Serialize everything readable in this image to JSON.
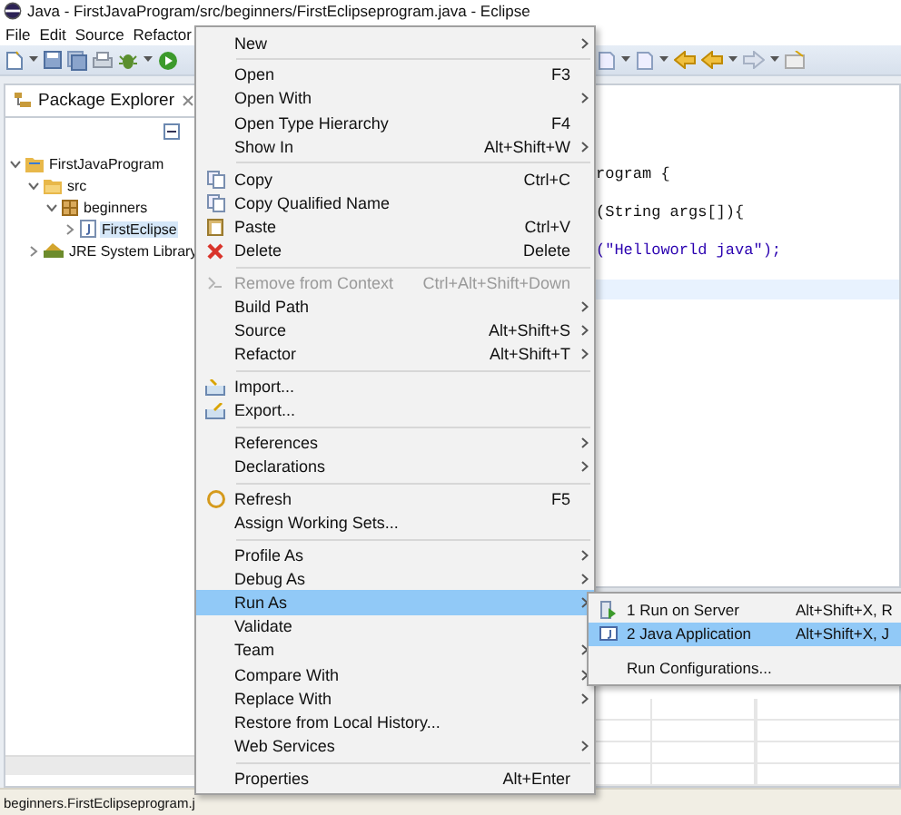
{
  "window": {
    "title": "Java - FirstJavaProgram/src/beginners/FirstEclipseprogram.java - Eclipse"
  },
  "menubar": [
    "File",
    "Edit",
    "Source",
    "Refactor"
  ],
  "package_explorer": {
    "title": "Package Explorer",
    "tree": [
      {
        "label": "FirstJavaProgram",
        "expanded": true,
        "children": [
          {
            "label": "src",
            "expanded": true,
            "children": [
              {
                "label": "beginners",
                "expanded": true,
                "children": [
                  {
                    "label": "FirstEclipse",
                    "expanded": false,
                    "selected": true
                  }
                ]
              }
            ]
          },
          {
            "label": "JRE System Library",
            "expanded": false,
            "selected": false
          }
        ]
      }
    ]
  },
  "editor": {
    "lines": [
      "rogram {",
      "(String args[]){",
      "(\"Helloworld java\");"
    ]
  },
  "context_menu": {
    "items": [
      {
        "kind": "command",
        "label": "New",
        "submenu": true,
        "disabled": false,
        "selected": false
      },
      {
        "kind": "separator"
      },
      {
        "kind": "command",
        "label": "Open",
        "shortcut": "F3",
        "submenu": false,
        "disabled": false,
        "selected": false
      },
      {
        "kind": "command",
        "label": "Open With",
        "submenu": true,
        "disabled": false,
        "selected": false
      },
      {
        "kind": "command",
        "label": "Open Type Hierarchy",
        "shortcut": "F4",
        "submenu": false,
        "disabled": false,
        "selected": false
      },
      {
        "kind": "command",
        "label": "Show In",
        "shortcut": "Alt+Shift+W",
        "submenu": true,
        "disabled": false,
        "selected": false
      },
      {
        "kind": "separator"
      },
      {
        "kind": "command",
        "label": "Copy",
        "shortcut": "Ctrl+C",
        "submenu": false,
        "disabled": false,
        "selected": false
      },
      {
        "kind": "command",
        "label": "Copy Qualified Name",
        "submenu": false,
        "disabled": false,
        "selected": false
      },
      {
        "kind": "command",
        "label": "Paste",
        "shortcut": "Ctrl+V",
        "submenu": false,
        "disabled": false,
        "selected": false
      },
      {
        "kind": "command",
        "label": "Delete",
        "shortcut": "Delete",
        "submenu": false,
        "disabled": false,
        "selected": false
      },
      {
        "kind": "separator"
      },
      {
        "kind": "command",
        "label": "Remove from Context",
        "shortcut": "Ctrl+Alt+Shift+Down",
        "submenu": false,
        "disabled": true,
        "selected": false
      },
      {
        "kind": "command",
        "label": "Build Path",
        "submenu": true,
        "disabled": false,
        "selected": false
      },
      {
        "kind": "command",
        "label": "Source",
        "shortcut": "Alt+Shift+S",
        "submenu": true,
        "disabled": false,
        "selected": false
      },
      {
        "kind": "command",
        "label": "Refactor",
        "shortcut": "Alt+Shift+T",
        "submenu": true,
        "disabled": false,
        "selected": false
      },
      {
        "kind": "separator"
      },
      {
        "kind": "command",
        "label": "Import...",
        "submenu": false,
        "disabled": false,
        "selected": false
      },
      {
        "kind": "command",
        "label": "Export...",
        "submenu": false,
        "disabled": false,
        "selected": false
      },
      {
        "kind": "separator"
      },
      {
        "kind": "command",
        "label": "References",
        "submenu": true,
        "disabled": false,
        "selected": false
      },
      {
        "kind": "command",
        "label": "Declarations",
        "submenu": true,
        "disabled": false,
        "selected": false
      },
      {
        "kind": "separator"
      },
      {
        "kind": "command",
        "label": "Refresh",
        "shortcut": "F5",
        "submenu": false,
        "disabled": false,
        "selected": false
      },
      {
        "kind": "command",
        "label": "Assign Working Sets...",
        "submenu": false,
        "disabled": false,
        "selected": false
      },
      {
        "kind": "separator"
      },
      {
        "kind": "command",
        "label": "Profile As",
        "submenu": true,
        "disabled": false,
        "selected": false
      },
      {
        "kind": "command",
        "label": "Debug As",
        "submenu": true,
        "disabled": false,
        "selected": false
      },
      {
        "kind": "command",
        "label": "Run As",
        "submenu": true,
        "disabled": false,
        "selected": true
      },
      {
        "kind": "command",
        "label": "Validate",
        "submenu": false,
        "disabled": false,
        "selected": false
      },
      {
        "kind": "command",
        "label": "Team",
        "submenu": true,
        "disabled": false,
        "selected": false
      },
      {
        "kind": "command",
        "label": "Compare With",
        "submenu": true,
        "disabled": false,
        "selected": false
      },
      {
        "kind": "command",
        "label": "Replace With",
        "submenu": true,
        "disabled": false,
        "selected": false
      },
      {
        "kind": "command",
        "label": "Restore from Local History...",
        "submenu": false,
        "disabled": false,
        "selected": false
      },
      {
        "kind": "command",
        "label": "Web Services",
        "submenu": true,
        "disabled": false,
        "selected": false
      },
      {
        "kind": "separator"
      },
      {
        "kind": "command",
        "label": "Properties",
        "shortcut": "Alt+Enter",
        "submenu": false,
        "disabled": false,
        "selected": false
      }
    ]
  },
  "run_as_submenu": {
    "items": [
      {
        "kind": "command",
        "label": "1 Run on Server",
        "shortcut": "Alt+Shift+X, R",
        "selected": false
      },
      {
        "kind": "command",
        "label": "2 Java Application",
        "shortcut": "Alt+Shift+X, J",
        "selected": true
      },
      {
        "kind": "separator"
      },
      {
        "kind": "command",
        "label": "Run Configurations...",
        "selected": false
      }
    ]
  },
  "status_bar": {
    "text": "beginners.FirstEclipseprogram.j"
  }
}
